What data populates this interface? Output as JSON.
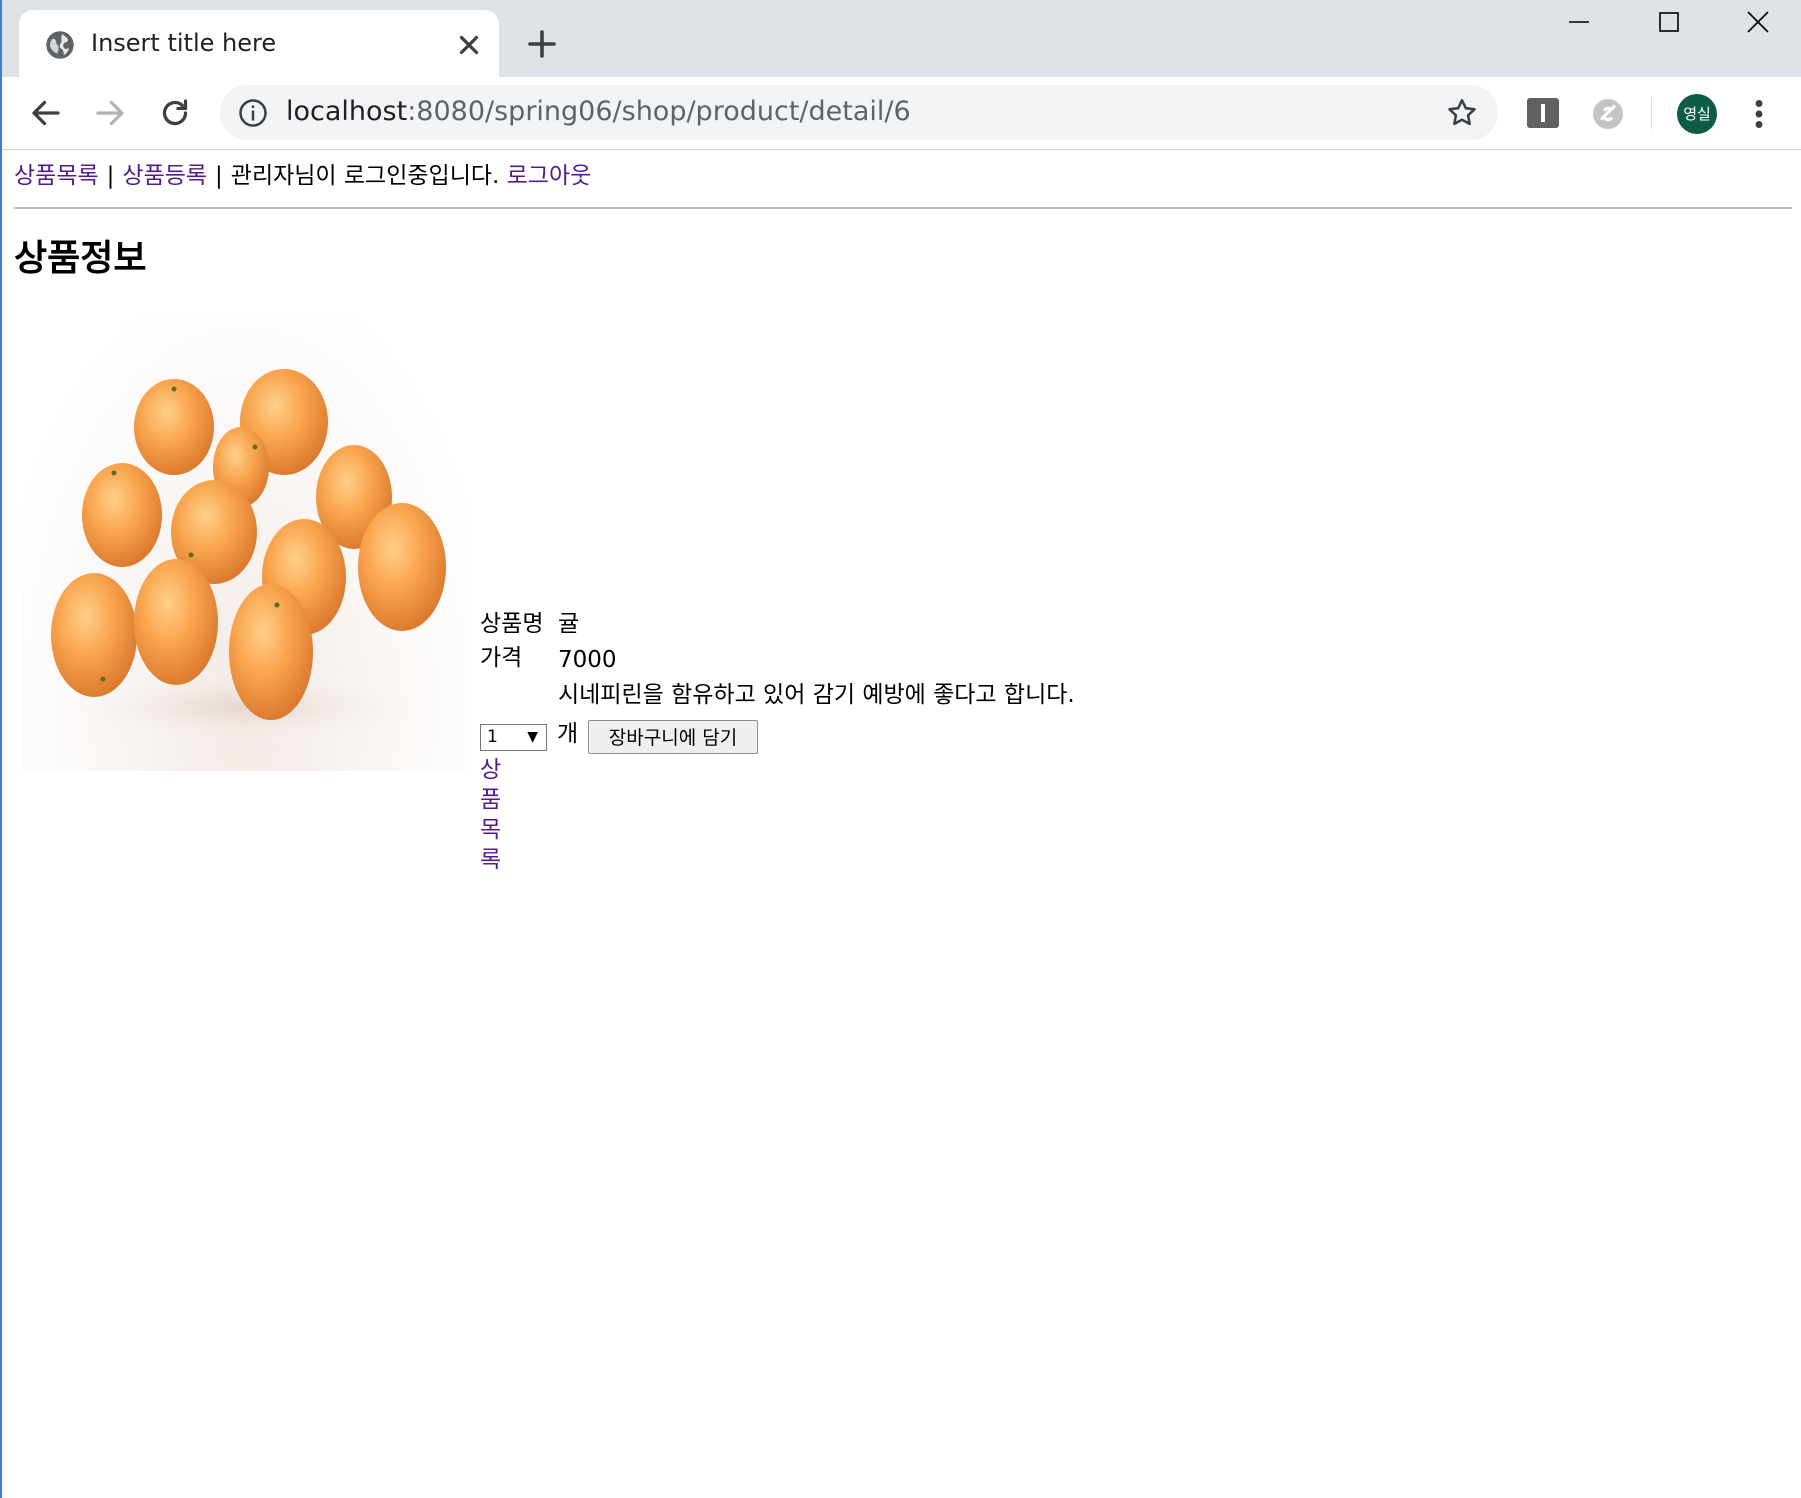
{
  "browser": {
    "tab_title": "Insert title here",
    "url_host": "localhost",
    "url_rest": ":8080/spring06/shop/product/detail/6",
    "profile_initials": "영실"
  },
  "nav": {
    "product_list": "상품목록",
    "separator": "|",
    "product_register": "상품등록",
    "status": "관리자님이 로그인중입니다.",
    "logout": "로그아웃"
  },
  "page": {
    "heading": "상품정보"
  },
  "product": {
    "name_label": "상품명",
    "name": "귤",
    "price_label": "가격",
    "price": "7000",
    "description": "시네피린을 함유하고 있어 감기 예방에 좋다고 합니다.",
    "image_icon": "orange-fruit-photo"
  },
  "cart": {
    "quantity": "1",
    "unit": "개",
    "add_button": "장바구니에 담기"
  },
  "footer_link": "상품목록",
  "colors": {
    "link": "#551a8b",
    "tabstrip": "#dee1e6",
    "omnibox": "#f1f3f4",
    "avatar": "#0d5c46"
  }
}
